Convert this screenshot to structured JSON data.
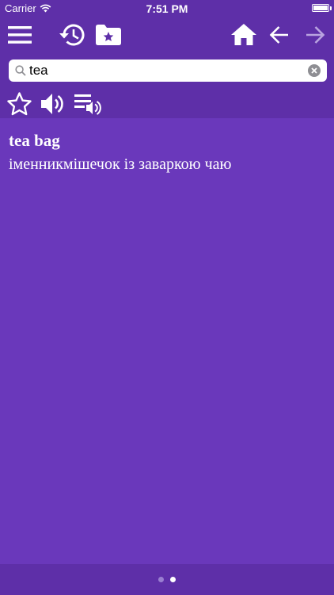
{
  "status_bar": {
    "carrier": "Carrier",
    "time": "7:51 PM",
    "battery_level": 1.0
  },
  "toolbar": {
    "icons": [
      "menu-icon",
      "history-icon",
      "bookmarks-folder-icon",
      "home-icon",
      "back-arrow-icon",
      "forward-arrow-icon"
    ]
  },
  "search": {
    "value": "tea",
    "icons": [
      "search-icon",
      "clear-icon"
    ]
  },
  "actions": {
    "icons": [
      "star-icon",
      "speaker-icon",
      "playlist-audio-icon"
    ]
  },
  "entry": {
    "headword": "tea bag",
    "translation": "іменникмішечок із заваркою чаю"
  },
  "pager": {
    "pages": 2,
    "current": 2
  },
  "colors": {
    "header": "#5e2fa8",
    "content": "#6a38bb",
    "text": "#ffffff",
    "disabled": "#b9a3e0"
  }
}
